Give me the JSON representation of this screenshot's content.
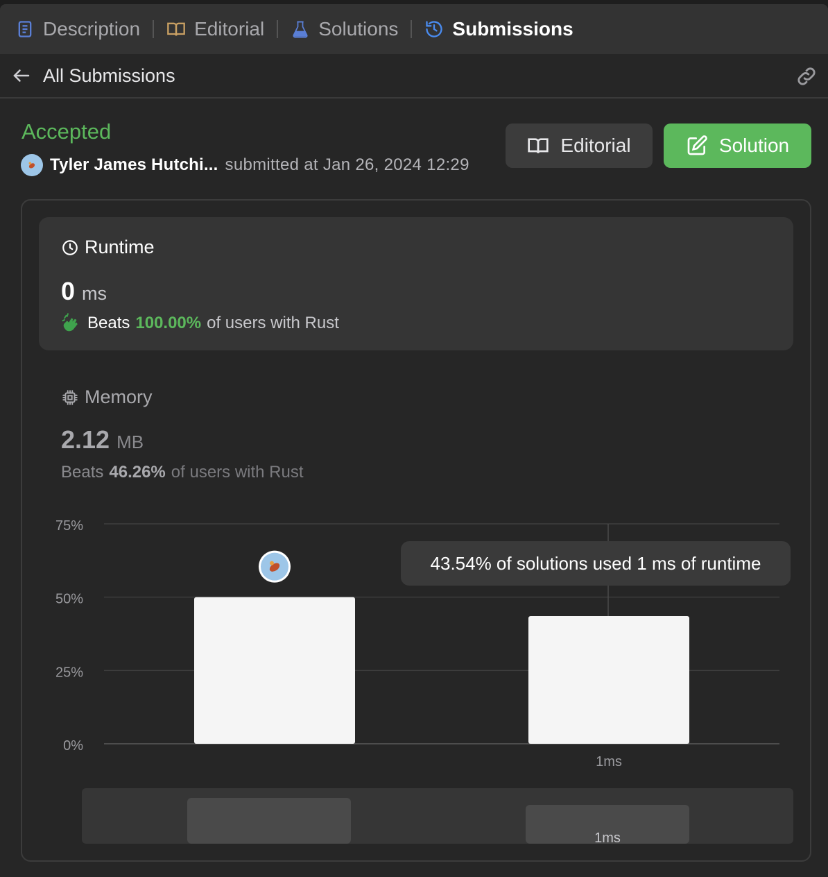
{
  "tabs": [
    {
      "label": "Description",
      "icon": "description-icon",
      "color": "#5a7fd6"
    },
    {
      "label": "Editorial",
      "icon": "book-icon",
      "color": "#c9a063"
    },
    {
      "label": "Solutions",
      "icon": "flask-icon",
      "color": "#5a7fd6"
    },
    {
      "label": "Submissions",
      "icon": "history-icon",
      "color": "#4a8cf0"
    }
  ],
  "subbar": {
    "title": "All Submissions"
  },
  "status": {
    "label": "Accepted",
    "color": "#5cb85c"
  },
  "submitter": {
    "name": "Tyler James Hutchi...",
    "submitted_text": "submitted at Jan 26, 2024 12:29"
  },
  "buttons": {
    "editorial": "Editorial",
    "solution": "Solution"
  },
  "runtime": {
    "heading": "Runtime",
    "value": "0",
    "unit": "ms",
    "beats_label": "Beats",
    "beats_pct": "100.00%",
    "beats_rest": "of users with Rust"
  },
  "memory": {
    "heading": "Memory",
    "value": "2.12",
    "unit": "MB",
    "beats_label": "Beats",
    "beats_pct": "46.26%",
    "beats_rest": "of users with Rust"
  },
  "tooltip": "43.54% of solutions used 1 ms of runtime",
  "chart_data": {
    "type": "bar",
    "categories": [
      "",
      "1ms"
    ],
    "values": [
      50,
      43.54
    ],
    "yticks": [
      "75%",
      "50%",
      "25%",
      "0%"
    ],
    "ylim": [
      0,
      75
    ],
    "grid": true,
    "user_marker_category": 0,
    "minimap_label": "1ms",
    "bar_color": "#f5f5f5"
  }
}
